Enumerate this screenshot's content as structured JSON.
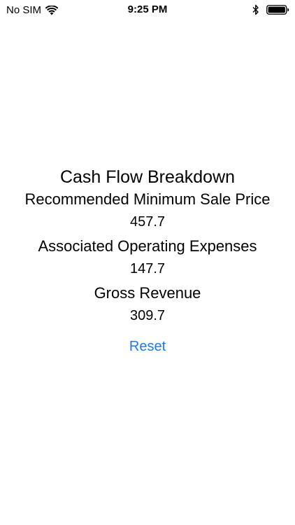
{
  "status_bar": {
    "carrier": "No SIM",
    "time": "9:25 PM",
    "icons": [
      "wifi-icon",
      "bluetooth-icon",
      "battery-icon"
    ]
  },
  "main": {
    "title": "Cash Flow Breakdown",
    "items": [
      {
        "label": "Recommended Minimum Sale Price",
        "value": "457.7"
      },
      {
        "label": "Associated Operating Expenses",
        "value": "147.7"
      },
      {
        "label": "Gross Revenue",
        "value": "309.7"
      }
    ],
    "reset_label": "Reset"
  },
  "colors": {
    "accent": "#1e7be3",
    "text": "#000000",
    "background": "#ffffff"
  }
}
